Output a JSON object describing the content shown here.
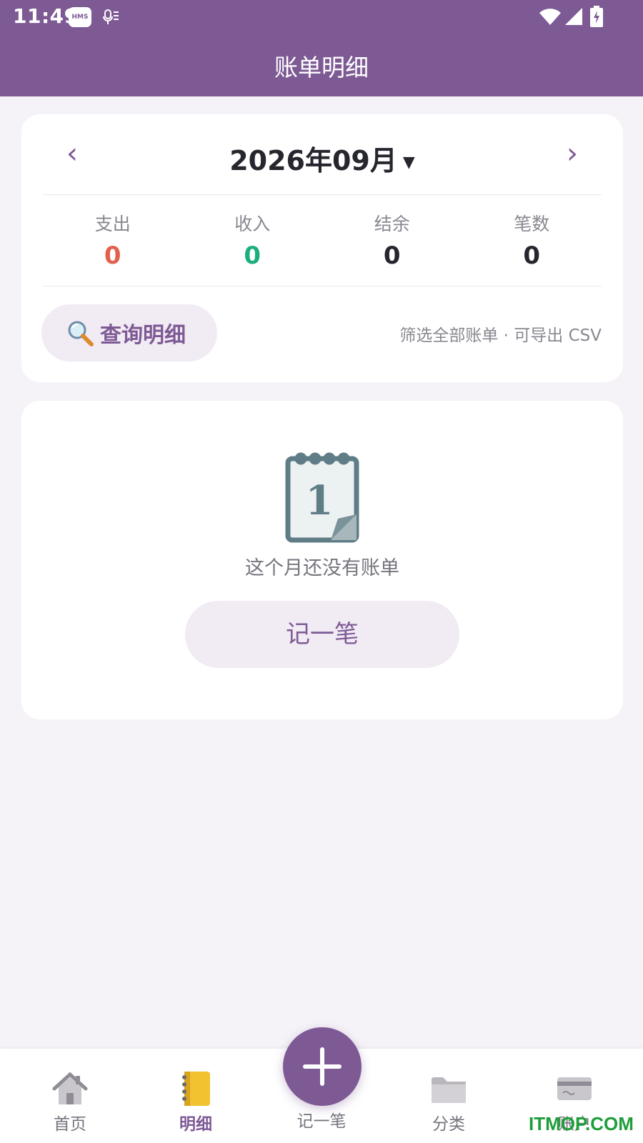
{
  "status_bar": {
    "time": "11:49",
    "hms_badge": "HMS"
  },
  "header": {
    "title": "账单明细"
  },
  "month_nav": {
    "prev_glyph": "‹",
    "next_glyph": "›",
    "month_label": "2026年09月",
    "caret": "▼"
  },
  "stats": [
    {
      "label": "支出",
      "value": "0",
      "color": "#E2614E"
    },
    {
      "label": "收入",
      "value": "0",
      "color": "#1BAE7E"
    },
    {
      "label": "结余",
      "value": "0",
      "color": "#26262E"
    },
    {
      "label": "笔数",
      "value": "0",
      "color": "#26262E"
    }
  ],
  "query": {
    "button_label": "查询明细",
    "hint": "筛选全部账单 · 可导出 CSV"
  },
  "empty_state": {
    "calendar_day": "1",
    "message": "这个月还没有账单",
    "button_label": "记一笔"
  },
  "bottom_nav": {
    "items": [
      {
        "label": "首页",
        "icon": "house-icon"
      },
      {
        "label": "明细",
        "icon": "notebook-icon",
        "active": true
      },
      {
        "label": "记一笔",
        "icon": "plus-icon"
      },
      {
        "label": "分类",
        "icon": "folder-icon"
      },
      {
        "label": "账户",
        "icon": "credit-card-icon"
      }
    ]
  },
  "watermark": "ITMOP.COM",
  "colors": {
    "primary": "#7E5A95",
    "background": "#F6F3F8",
    "pill": "#F1EBF4"
  }
}
